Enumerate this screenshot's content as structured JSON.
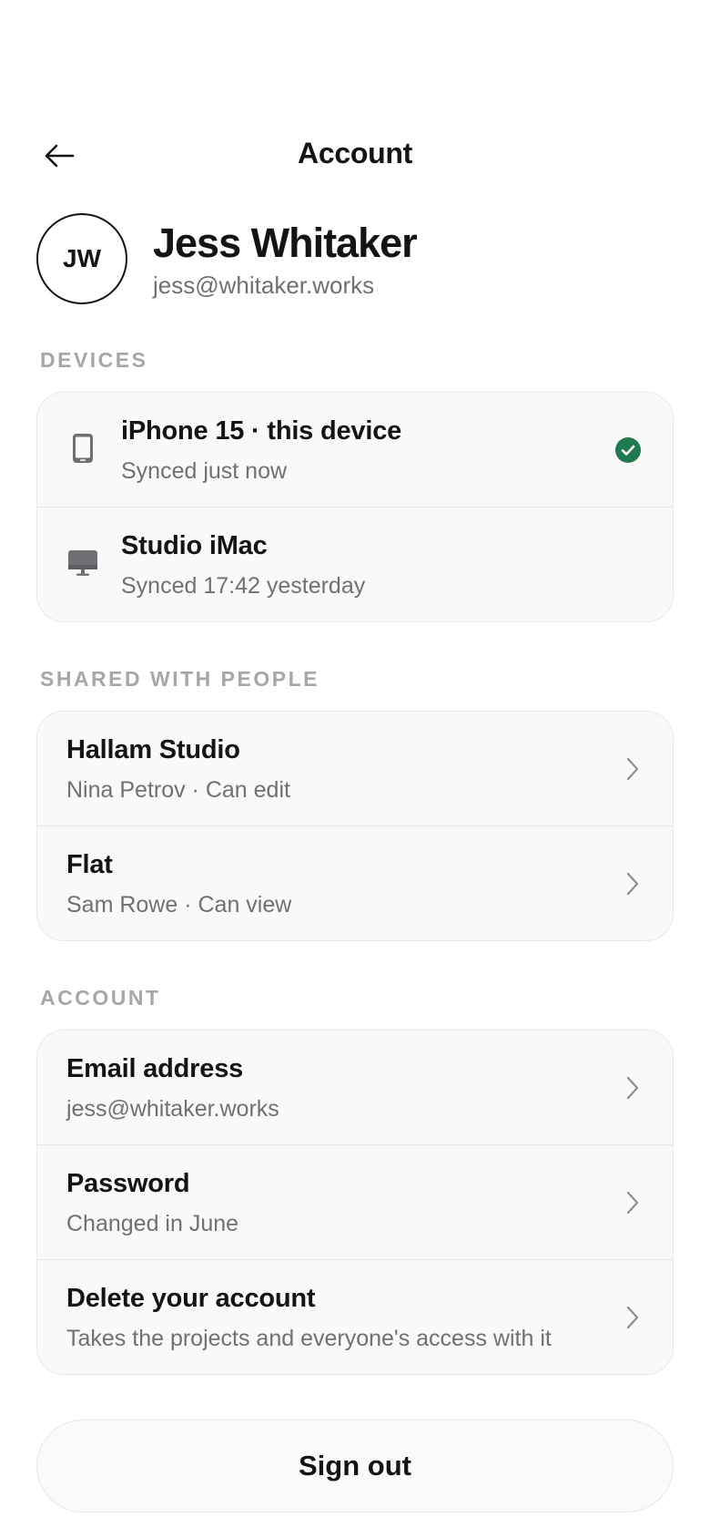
{
  "header": {
    "title": "Account"
  },
  "profile": {
    "initials": "JW",
    "name": "Jess Whitaker",
    "email": "jess@whitaker.works"
  },
  "devices": {
    "label": "DEVICES",
    "items": [
      {
        "name": "iPhone 15 · this device",
        "status": "Synced just now",
        "icon": "phone-icon",
        "current": true
      },
      {
        "name": "Studio iMac",
        "status": "Synced 17:42 yesterday",
        "icon": "desktop-icon",
        "current": false
      }
    ]
  },
  "shared": {
    "label": "SHARED WITH PEOPLE",
    "items": [
      {
        "title": "Hallam Studio",
        "subtitle": "Nina Petrov · Can edit"
      },
      {
        "title": "Flat",
        "subtitle": "Sam Rowe · Can view"
      }
    ]
  },
  "account": {
    "label": "ACCOUNT",
    "items": [
      {
        "title": "Email address",
        "subtitle": "jess@whitaker.works"
      },
      {
        "title": "Password",
        "subtitle": "Changed in June"
      },
      {
        "title": "Delete your account",
        "subtitle": "Takes the projects and everyone's access with it"
      }
    ]
  },
  "sign_out_label": "Sign out",
  "colors": {
    "accent_green": "#1f7a4f",
    "text_primary": "#141414",
    "text_secondary": "#707075",
    "section_label": "#a6a6ab",
    "card_bg": "#f9f9f9"
  }
}
